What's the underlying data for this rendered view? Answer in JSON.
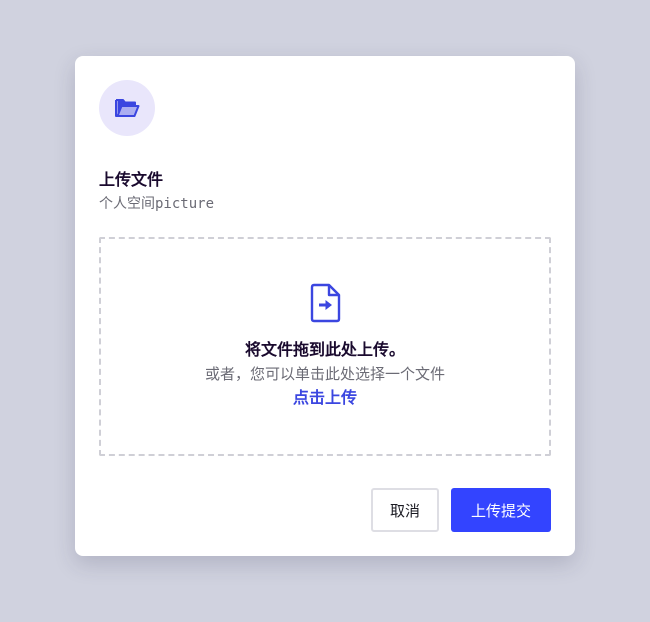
{
  "dialog": {
    "title": "上传文件",
    "subtitle": "个人空间picture",
    "header_icon": "folder-open-icon"
  },
  "dropzone": {
    "icon": "file-arrow-icon",
    "title": "将文件拖到此处上传。",
    "hint": "或者，您可以单击此处选择一个文件",
    "link_label": "点击上传"
  },
  "actions": {
    "cancel_label": "取消",
    "submit_label": "上传提交"
  },
  "colors": {
    "accent": "#3344ff",
    "accent_text": "#3b46e0",
    "icon_bg": "#e9e6fb",
    "page_bg": "#d0d2df"
  }
}
